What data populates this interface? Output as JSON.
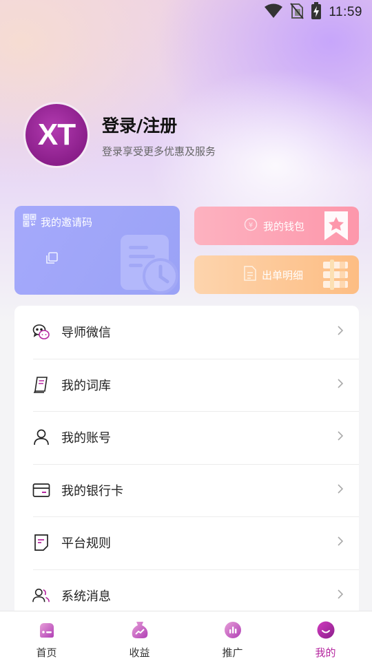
{
  "status_bar": {
    "time": "11:59",
    "icons": [
      "wifi-icon",
      "no-sim-icon",
      "battery-charging-icon"
    ]
  },
  "profile": {
    "avatar_text": "XT",
    "title": "登录/注册",
    "subtitle": "登录享受更多优惠及服务"
  },
  "cards": {
    "invite": {
      "label": "我的邀请码",
      "icon": "qr-code-icon"
    },
    "wallet": {
      "label": "我的钱包",
      "icon": "yen-coin-icon"
    },
    "bill": {
      "label": "出单明细",
      "icon": "document-icon"
    }
  },
  "menu": {
    "items": [
      {
        "label": "导师微信",
        "icon": "wechat-icon"
      },
      {
        "label": "我的词库",
        "icon": "notebook-icon"
      },
      {
        "label": "我的账号",
        "icon": "user-icon"
      },
      {
        "label": "我的银行卡",
        "icon": "bank-card-icon"
      },
      {
        "label": "平台规则",
        "icon": "rules-icon"
      },
      {
        "label": "系统消息",
        "icon": "users-message-icon"
      }
    ]
  },
  "tabbar": {
    "items": [
      {
        "label": "首页",
        "icon": "home-icon",
        "active": false
      },
      {
        "label": "收益",
        "icon": "money-bag-icon",
        "active": false
      },
      {
        "label": "推广",
        "icon": "chart-icon",
        "active": false
      },
      {
        "label": "我的",
        "icon": "smile-icon",
        "active": true
      }
    ]
  },
  "colors": {
    "accent": "#b5269f",
    "invite_card": "#9ea5f8",
    "wallet_card": "#fda4b6",
    "bill_card": "#fdc891"
  }
}
